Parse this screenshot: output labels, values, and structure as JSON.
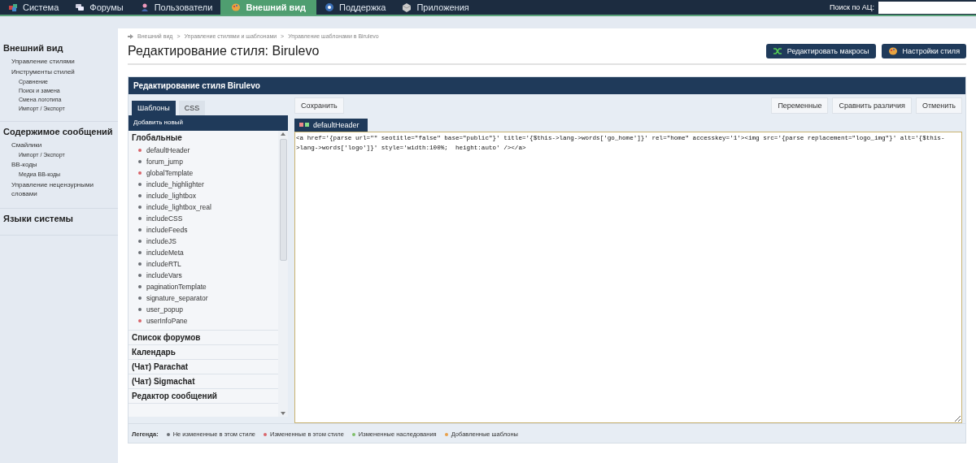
{
  "nav": {
    "tabs": [
      {
        "label": "Система",
        "selected": false
      },
      {
        "label": "Форумы",
        "selected": false
      },
      {
        "label": "Пользователи",
        "selected": false
      },
      {
        "label": "Внешний вид",
        "selected": true
      },
      {
        "label": "Поддержка",
        "selected": false
      },
      {
        "label": "Приложения",
        "selected": false
      }
    ],
    "search_label": "Поиск по АЦ:"
  },
  "sidebar": {
    "sections": [
      {
        "title": "Внешний вид",
        "items": [
          {
            "label": "Управление стилями"
          },
          {
            "label": "Инструменты стилей",
            "children": [
              {
                "label": "Сравнение"
              },
              {
                "label": "Поиск и замена"
              },
              {
                "label": "Смена логотипа"
              },
              {
                "label": "Импорт / Экспорт"
              }
            ]
          }
        ]
      },
      {
        "title": "Содержимое сообщений",
        "items": [
          {
            "label": "Смайлики",
            "children": [
              {
                "label": "Импорт / Экспорт"
              }
            ]
          },
          {
            "label": "ВВ-коды",
            "children": [
              {
                "label": "Медиа ВВ-коды"
              }
            ]
          },
          {
            "label": "Управление нецензурными словами"
          }
        ]
      },
      {
        "title": "Языки системы"
      }
    ]
  },
  "breadcrumbs": [
    "Внешний вид",
    "Управление стилями и шаблонами",
    "Управление шаблонами в Birulevo"
  ],
  "breadcrumb_separator": ">",
  "title": "Редактирование стиля: Birulevo",
  "header_buttons": [
    "Редактировать макросы",
    "Настройки стиля"
  ],
  "panel": {
    "title": "Редактирование стиля Birulevo",
    "list_tabs": [
      {
        "label": "Шаблоны",
        "selected": true
      },
      {
        "label": "CSS",
        "selected": false
      }
    ],
    "add_new": "Добавить новый",
    "groups": [
      {
        "title": "Глобальные",
        "expanded": true,
        "templates": [
          {
            "name": "defaultHeader",
            "color": "#d9656b"
          },
          {
            "name": "forum_jump",
            "color": "#6b6f75"
          },
          {
            "name": "globalTemplate",
            "color": "#d9656b"
          },
          {
            "name": "include_highlighter",
            "color": "#6b6f75"
          },
          {
            "name": "include_lightbox",
            "color": "#6b6f75"
          },
          {
            "name": "include_lightbox_real",
            "color": "#6b6f75"
          },
          {
            "name": "includeCSS",
            "color": "#6b6f75"
          },
          {
            "name": "includeFeeds",
            "color": "#6b6f75"
          },
          {
            "name": "includeJS",
            "color": "#6b6f75"
          },
          {
            "name": "includeMeta",
            "color": "#6b6f75"
          },
          {
            "name": "includeRTL",
            "color": "#6b6f75"
          },
          {
            "name": "includeVars",
            "color": "#6b6f75"
          },
          {
            "name": "paginationTemplate",
            "color": "#6b6f75"
          },
          {
            "name": "signature_separator",
            "color": "#6b6f75"
          },
          {
            "name": "user_popup",
            "color": "#6b6f75"
          },
          {
            "name": "userInfoPane",
            "color": "#d9656b"
          }
        ]
      },
      {
        "title": "Список форумов",
        "expanded": false
      },
      {
        "title": "Календарь",
        "expanded": false
      },
      {
        "title": "(Чат) Parachat",
        "expanded": false
      },
      {
        "title": "(Чат) Sigmachat",
        "expanded": false
      },
      {
        "title": "Редактор сообщений",
        "expanded": false
      }
    ],
    "save_button": "Сохранить",
    "right_buttons": [
      "Переменные",
      "Сравнить различия",
      "Отменить"
    ],
    "editor_tab": "defaultHeader",
    "code": "<a href='{parse url=\"\" seotitle=\"false\" base=\"public\"}' title='{$this->lang->words['go_home']}' rel=\"home\" accesskey='1'><img src='{parse replacement=\"logo_img\"}' alt='{$this->lang->words['logo']}' style='width:100%;  height:auto' /></a>",
    "legend_label": "Легенда:",
    "legend": [
      {
        "label": "Не измененные в этом стиле",
        "color": "#6b6f75"
      },
      {
        "label": "Измененные в этом стиле",
        "color": "#d9656b"
      },
      {
        "label": "Измененные наследования",
        "color": "#7fbf6a"
      },
      {
        "label": "Добавленные шаблоны",
        "color": "#e8a04a"
      }
    ]
  }
}
